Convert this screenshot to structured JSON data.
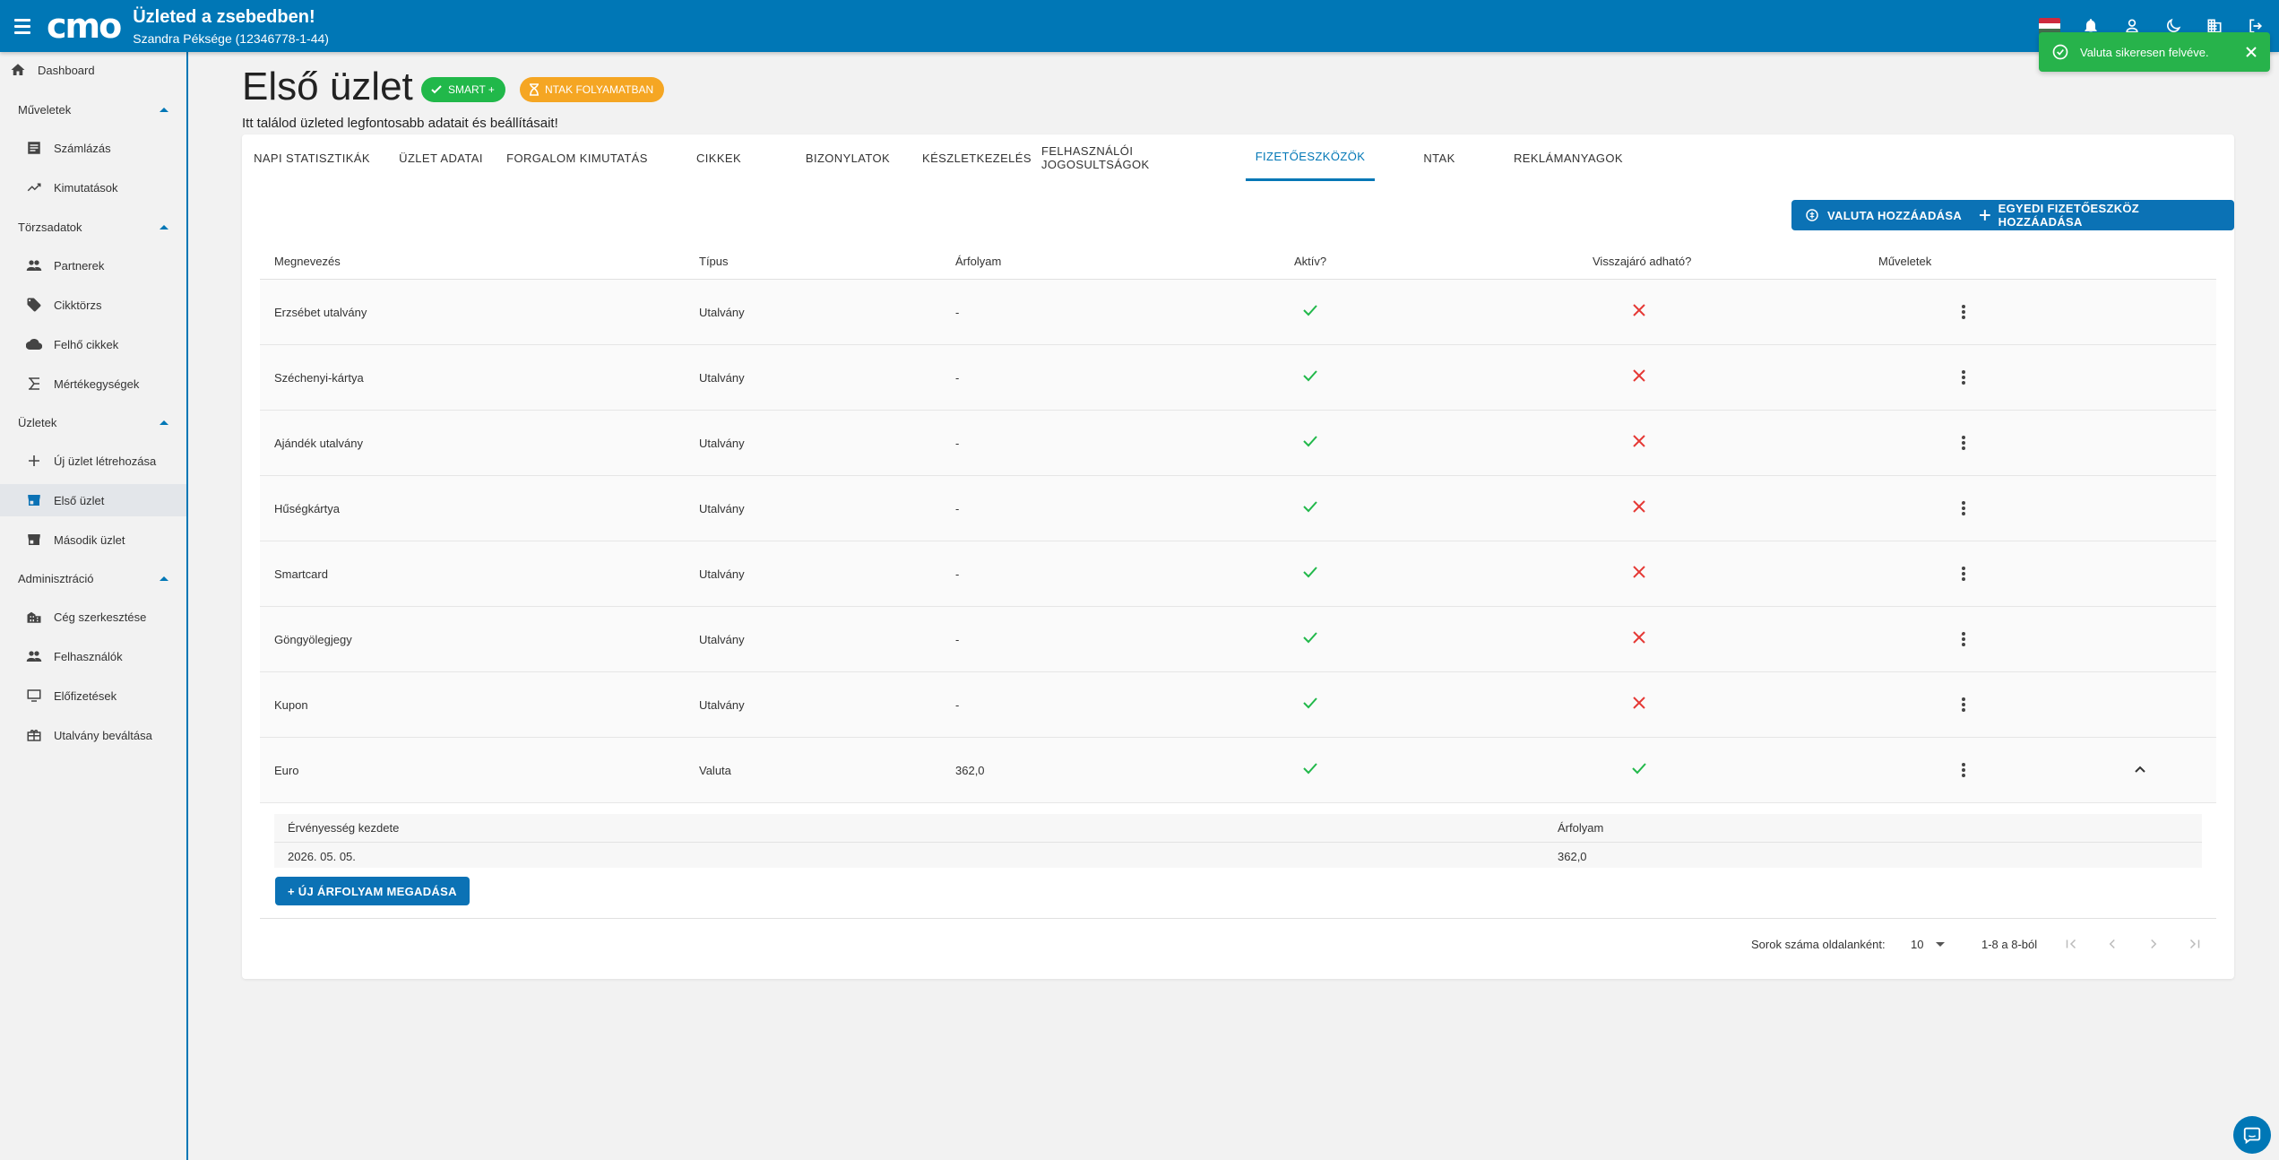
{
  "app": {
    "title": "Üzleted a zsebedben!",
    "subtitle": "Szandra Péksége (12346778-1-44)",
    "logo_text": "cmo",
    "brand_color": "#0077b6"
  },
  "sidebar": {
    "dashboard": "Dashboard",
    "sections": [
      {
        "label": "Műveletek",
        "items": [
          "Számlázás",
          "Kimutatások"
        ]
      },
      {
        "label": "Törzsadatok",
        "items": [
          "Partnerek",
          "Cikktörzs",
          "Felhő cikkek",
          "Mértékegységek"
        ]
      },
      {
        "label": "Üzletek",
        "items": [
          "Új üzlet létrehozása",
          "Első üzlet",
          "Második üzlet"
        ]
      },
      {
        "label": "Adminisztráció",
        "items": [
          "Cég szerkesztése",
          "Felhasználók",
          "Előfizetések",
          "Utalvány beváltása"
        ]
      }
    ],
    "active_item": "Első üzlet"
  },
  "page": {
    "title": "Első üzlet",
    "subtitle": "Itt találod üzleted legfontosabb adatait és beállításait!",
    "badges": {
      "smart": "SMART +",
      "ntak": "NTAK FOLYAMATBAN"
    }
  },
  "tabs": [
    "NAPI STATISZTIKÁK",
    "ÜZLET ADATAI",
    "FORGALOM KIMUTATÁS",
    "CIKKEK",
    "BIZONYLATOK",
    "KÉSZLETKEZELÉS",
    "FELHASZNÁLÓI JOGOSULTSÁGOK",
    "FIZETŐESZKÖZÖK",
    "NTAK",
    "REKLÁMANYAGOK"
  ],
  "active_tab": "FIZETŐESZKÖZÖK",
  "actions": {
    "add_currency": "VALUTA HOZZÁADÁSA",
    "add_custom": "EGYEDI FIZETŐESZKÖZ HOZZÁADÁSA"
  },
  "table": {
    "headers": [
      "Megnevezés",
      "Típus",
      "Árfolyam",
      "Aktív?",
      "Visszajáró adható?",
      "Műveletek"
    ],
    "rows": [
      {
        "name": "Erzsébet utalvány",
        "type": "Utalvány",
        "rate": "-",
        "active": true,
        "change": false
      },
      {
        "name": "Széchenyi-kártya",
        "type": "Utalvány",
        "rate": "-",
        "active": true,
        "change": false
      },
      {
        "name": "Ajándék utalvány",
        "type": "Utalvány",
        "rate": "-",
        "active": true,
        "change": false
      },
      {
        "name": "Hűségkártya",
        "type": "Utalvány",
        "rate": "-",
        "active": true,
        "change": false
      },
      {
        "name": "Smartcard",
        "type": "Utalvány",
        "rate": "-",
        "active": true,
        "change": false
      },
      {
        "name": "Göngyölegjegy",
        "type": "Utalvány",
        "rate": "-",
        "active": true,
        "change": false
      },
      {
        "name": "Kupon",
        "type": "Utalvány",
        "rate": "-",
        "active": true,
        "change": false
      },
      {
        "name": "Euro",
        "type": "Valuta",
        "rate": "362,0",
        "active": true,
        "change": true
      }
    ]
  },
  "rates_sub": {
    "headers": [
      "Érvényesség kezdete",
      "Árfolyam"
    ],
    "rows": [
      {
        "date": "2026. 05. 05.",
        "rate": "362,0"
      }
    ],
    "new_rate_button": "+ ÚJ ÁRFOLYAM MEGADÁSA"
  },
  "pagination": {
    "rows_per_page_label": "Sorok száma oldalanként:",
    "rows_per_page": "10",
    "range": "1-8 a 8-ból"
  },
  "toast": {
    "message": "Valuta sikeresen felvéve."
  },
  "colors": {
    "success": "#21b84a",
    "error": "#e53935",
    "warning": "#f5a623"
  }
}
